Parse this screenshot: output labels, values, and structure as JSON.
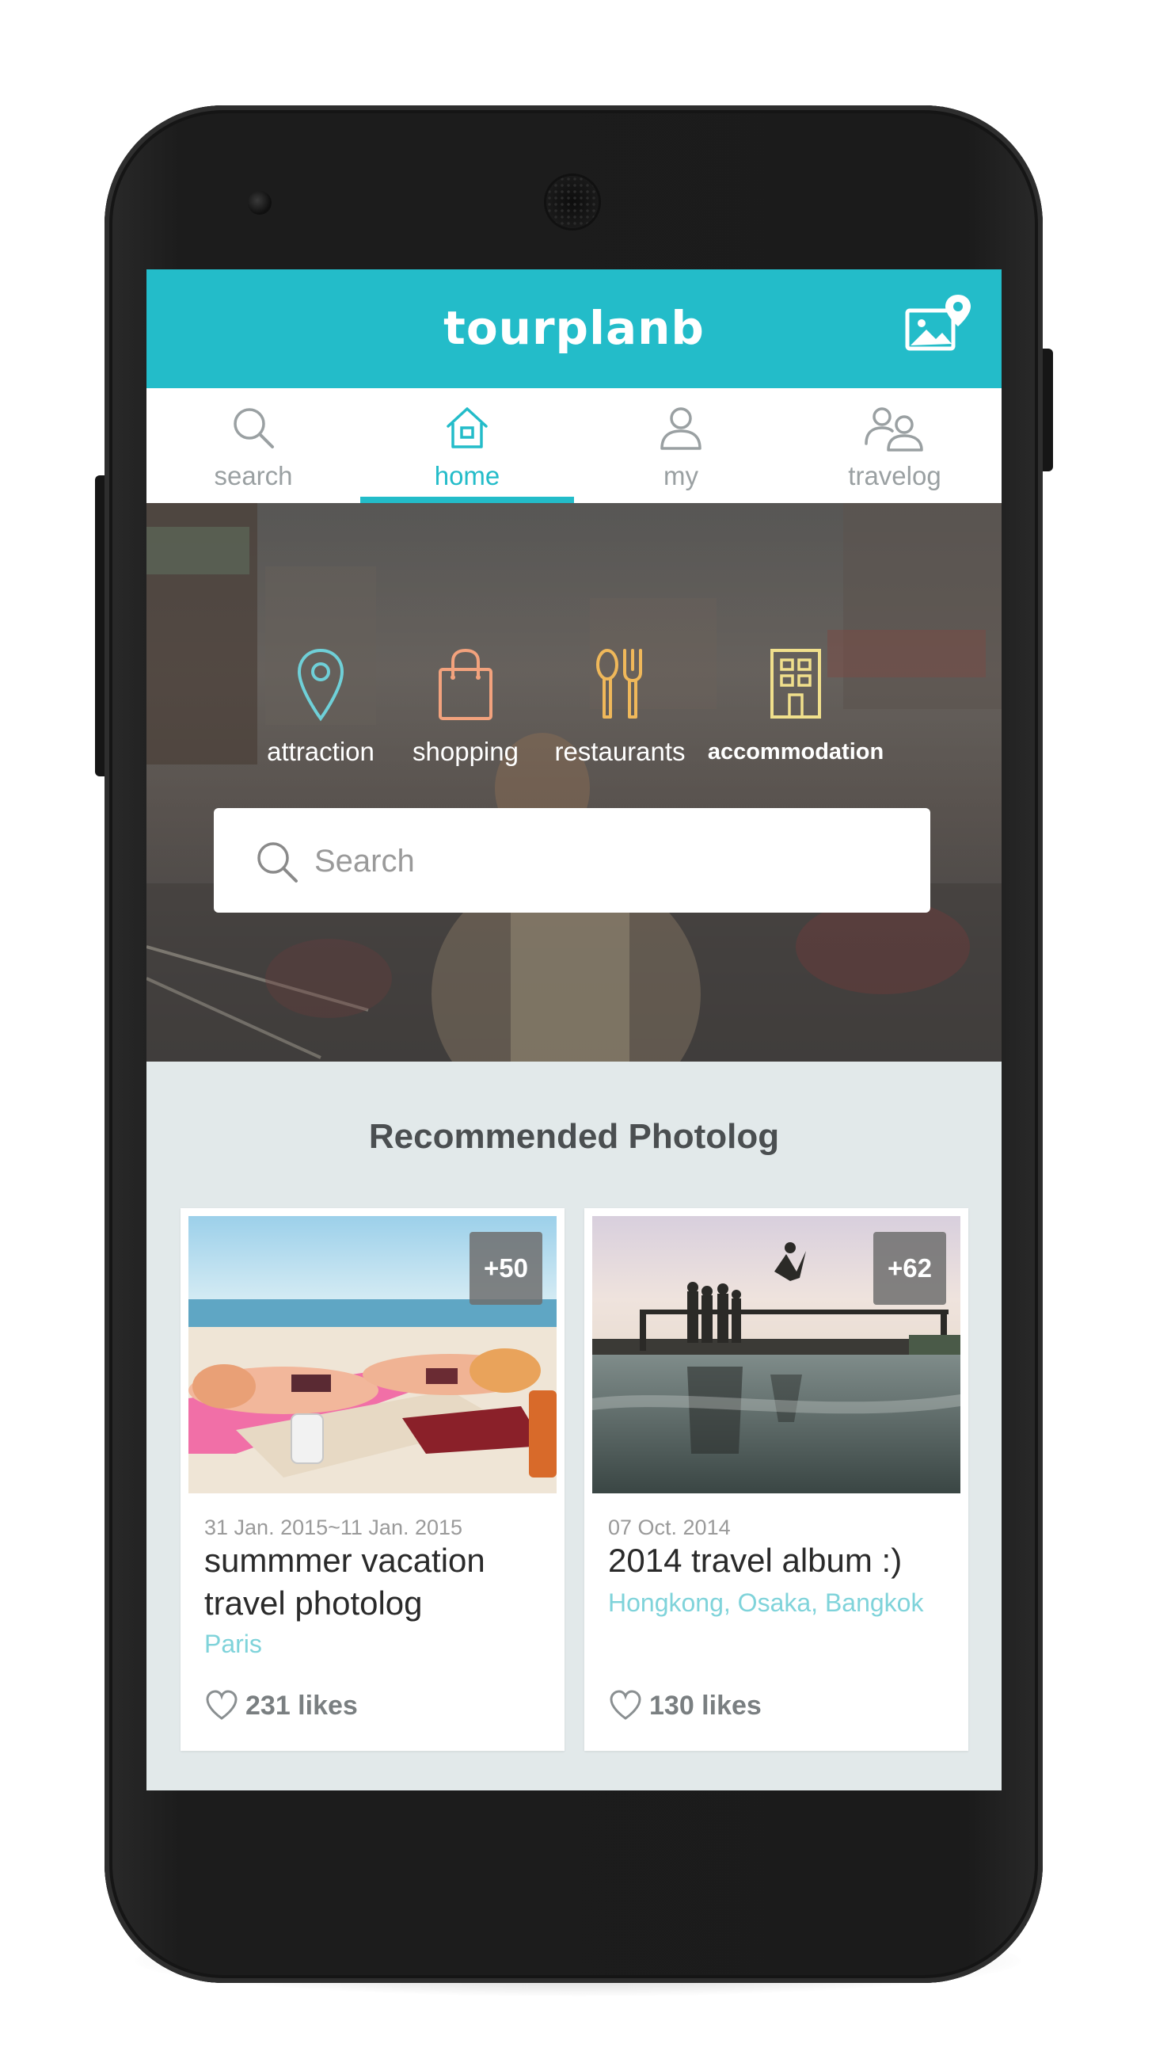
{
  "app": {
    "title": "tourplanb"
  },
  "colors": {
    "brand": "#23bcc9",
    "location_text": "#7fd3da",
    "attraction_icon": "#6fd0d8",
    "shopping_icon": "#f3a27d",
    "restaurants_icon": "#f0b85a",
    "accommodation_icon": "#f1e08c"
  },
  "tabs": [
    {
      "label": "search",
      "icon": "search-icon",
      "active": false
    },
    {
      "label": "home",
      "icon": "home-icon",
      "active": true
    },
    {
      "label": "my",
      "icon": "user-icon",
      "active": false
    },
    {
      "label": "travelog",
      "icon": "group-icon",
      "active": false
    }
  ],
  "categories": [
    {
      "label": "attraction",
      "icon": "map-pin-icon"
    },
    {
      "label": "shopping",
      "icon": "shopping-bag-icon"
    },
    {
      "label": "restaurants",
      "icon": "fork-spoon-icon"
    },
    {
      "label": "accommodation",
      "icon": "building-icon"
    }
  ],
  "search": {
    "placeholder": "Search",
    "value": ""
  },
  "recommended": {
    "title": "Recommended Photolog",
    "cards": [
      {
        "count": "+50",
        "date": "31 Jan. 2015~11 Jan. 2015",
        "title": "summmer vacation travel photolog",
        "location": "Paris",
        "likes": "231 likes"
      },
      {
        "count": "+62",
        "date": "07 Oct. 2014",
        "title": "2014 travel album :)",
        "location": "Hongkong, Osaka, Bangkok",
        "likes": "130 likes"
      }
    ]
  }
}
